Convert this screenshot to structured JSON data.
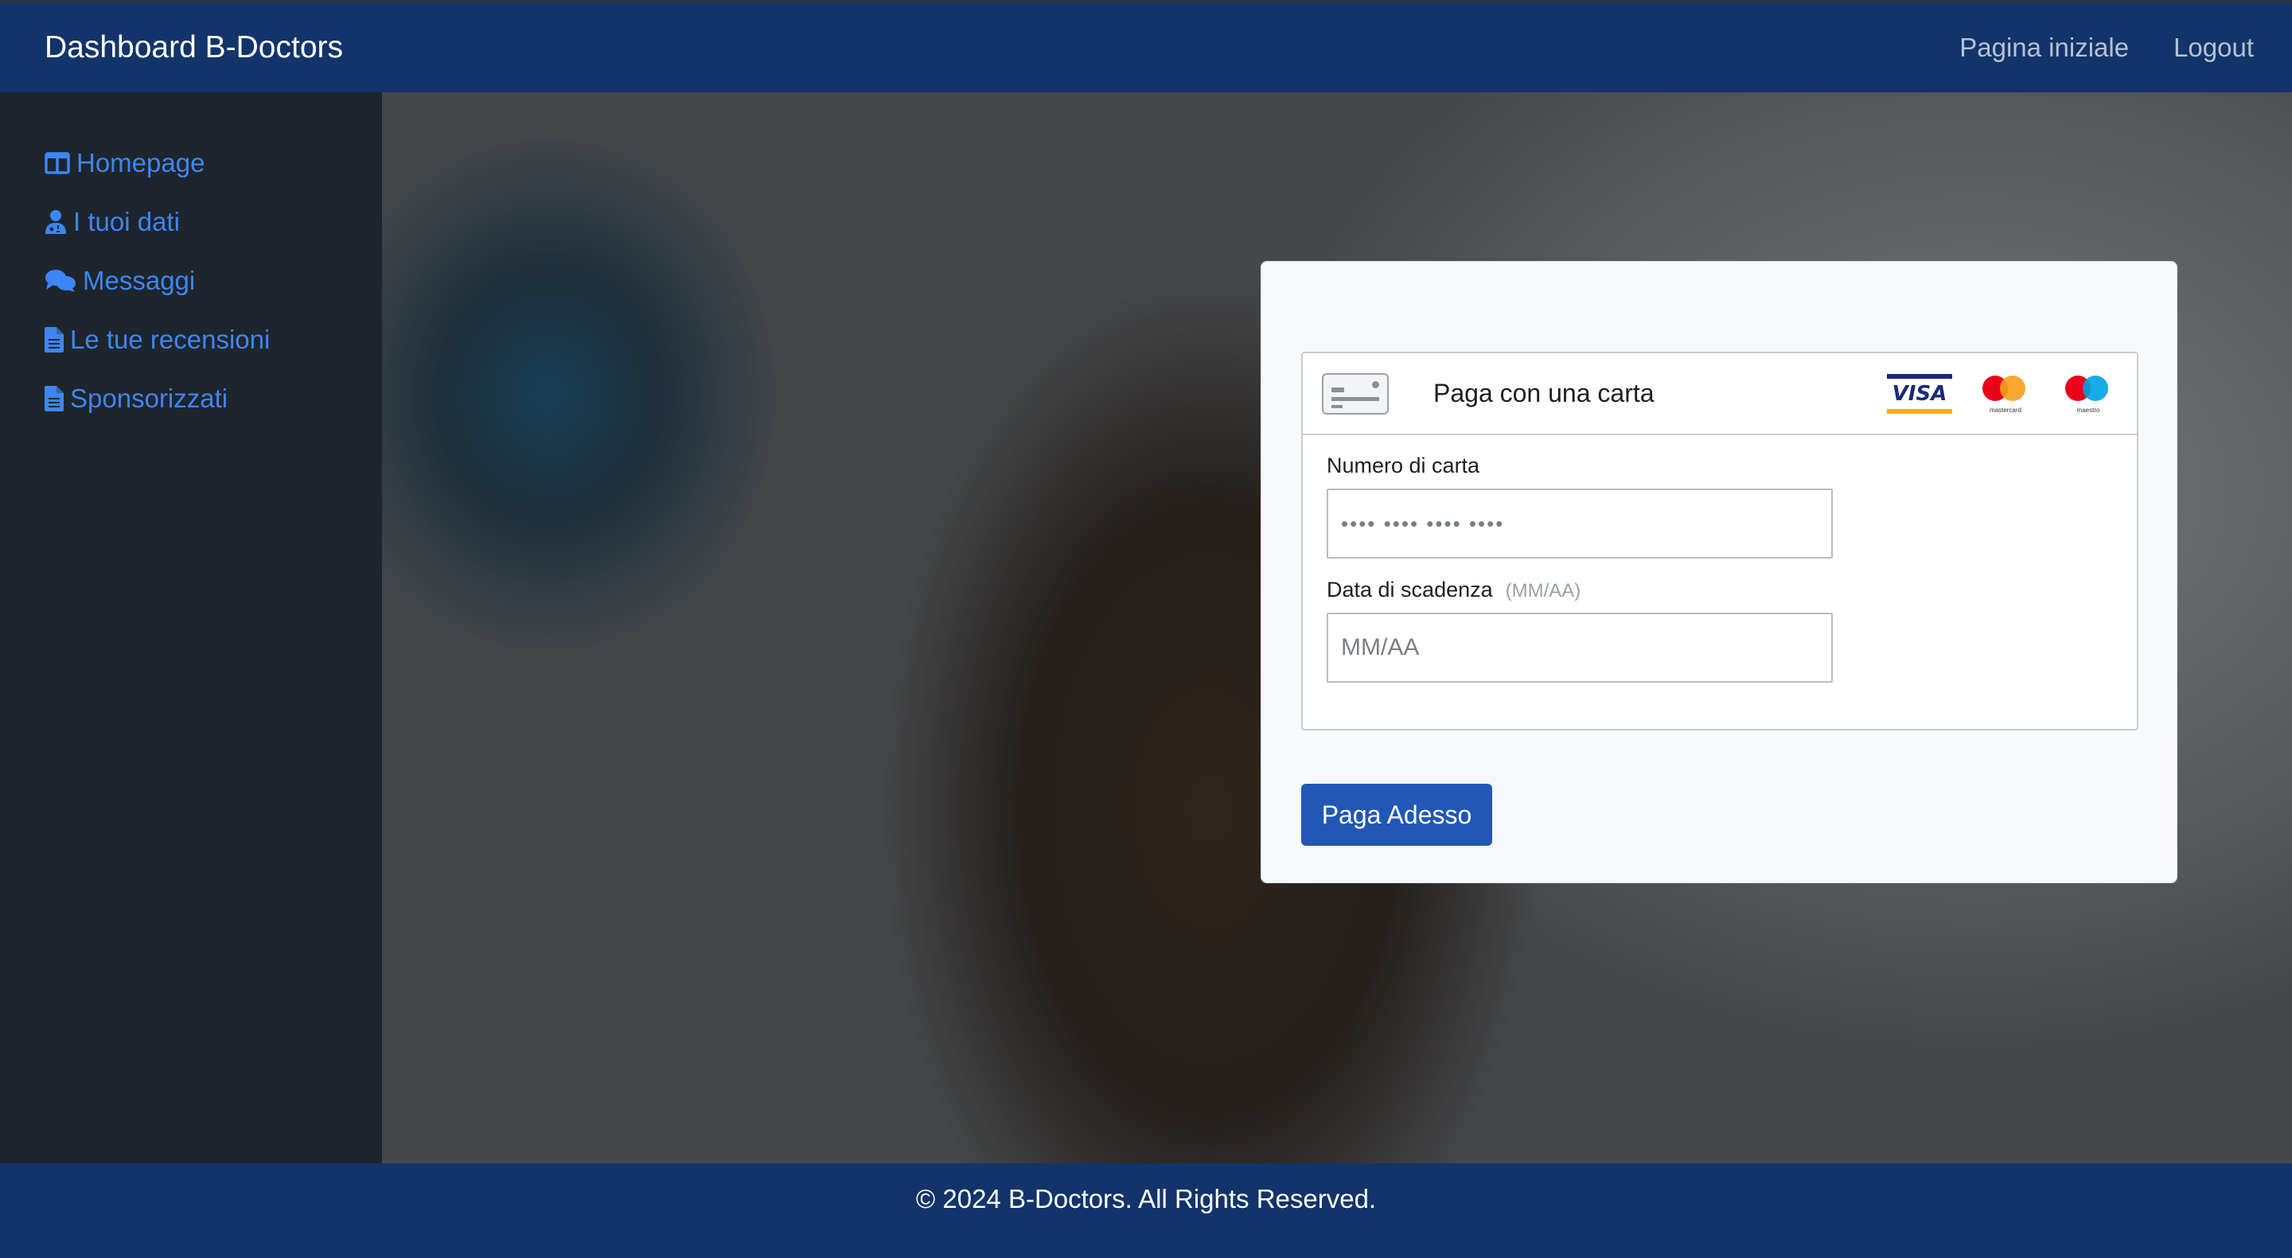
{
  "header": {
    "brand": "Dashboard B-Doctors",
    "links": [
      "Pagina iniziale",
      "Logout"
    ]
  },
  "sidebar": {
    "items": [
      {
        "label": "Homepage",
        "icon": "columns-icon"
      },
      {
        "label": "I tuoi dati",
        "icon": "user-doctor-icon"
      },
      {
        "label": "Messaggi",
        "icon": "comments-icon"
      },
      {
        "label": "Le tue recensioni",
        "icon": "file-icon"
      },
      {
        "label": "Sponsorizzati",
        "icon": "file-icon"
      }
    ]
  },
  "payment": {
    "title": "Paga con una carta",
    "brands": [
      "VISA",
      "mastercard",
      "maestro"
    ],
    "card_number": {
      "label": "Numero di carta",
      "placeholder": "•••• •••• •••• ••••"
    },
    "expiry": {
      "label": "Data di scadenza",
      "hint": "(MM/AA)",
      "placeholder": "MM/AA"
    },
    "submit_label": "Paga Adesso"
  },
  "footer": {
    "text": "© 2024 B-Doctors. All Rights Reserved."
  },
  "colors": {
    "navbar": "#12346a",
    "sidebar": "#1f252c",
    "link": "#3d86f4",
    "button": "#2257b7"
  }
}
